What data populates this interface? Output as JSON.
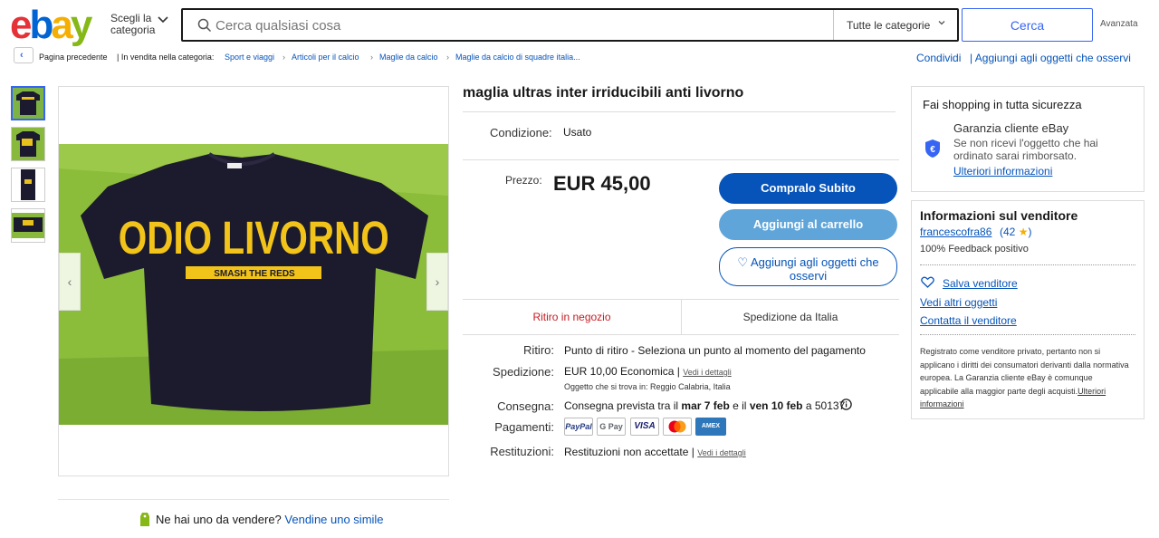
{
  "header": {
    "logo": [
      "e",
      "b",
      "a",
      "y"
    ],
    "shop_by_line1": "Scegli la",
    "shop_by_line2": "categoria",
    "search_placeholder": "Cerca qualsiasi cosa",
    "category_select": "Tutte le categorie",
    "search_button": "Cerca",
    "advanced": "Avanzata"
  },
  "breadcrumb": {
    "back": "Pagina precedente",
    "prefix": "| In vendita nella categoria:",
    "items": [
      "Sport e viaggi",
      "Articoli per il calcio",
      "Maglie da calcio",
      "Maglie da calcio di squadre italia..."
    ],
    "share": "Condividi",
    "add_watch": "| Aggiungi agli oggetti che osservi"
  },
  "item": {
    "title": "maglia ultras inter irriducibili anti livorno",
    "condition_label": "Condizione:",
    "condition_value": "Usato",
    "price_label": "Prezzo:",
    "price": "EUR 45,00",
    "buy_now": "Compralo Subito",
    "add_to_cart": "Aggiungi al carrello",
    "watch_line1": "♡ Aggiungi agli oggetti che",
    "watch_line2": "osservi",
    "shirt_text": "ODIO LIVORNO",
    "shirt_subtext": "SMASH THE REDS"
  },
  "tabs": {
    "pickup": "Ritiro in negozio",
    "shipping_from": "Spedizione da Italia"
  },
  "details": {
    "pickup_label": "Ritiro:",
    "pickup_value": "Punto di ritiro - Seleziona un punto al momento del pagamento",
    "shipping_label": "Spedizione:",
    "shipping_price": "EUR 10,00",
    "shipping_type": "Economica |",
    "shipping_link": "Vedi i dettagli",
    "location_note": "Oggetto che si trova in: Reggio Calabria, Italia",
    "delivery_label": "Consegna:",
    "delivery_pre": "Consegna prevista tra il",
    "delivery_d1": "mar 7 feb",
    "delivery_mid": "e il",
    "delivery_d2": "ven 10 feb",
    "delivery_post": "a 50137",
    "payments_label": "Pagamenti:",
    "payments": [
      "PayPal",
      "G Pay",
      "VISA",
      "",
      "AMEX"
    ],
    "returns_label": "Restituzioni:",
    "returns_value": "Restituzioni non accettate |",
    "returns_link": "Vedi i dettagli"
  },
  "sell": {
    "question": "Ne hai uno da vendere?",
    "link": "Vendine uno simile"
  },
  "safety": {
    "title": "Fai shopping in tutta sicurezza",
    "guarantee_title": "Garanzia cliente eBay",
    "guarantee_line1": "Se non ricevi l'oggetto che hai",
    "guarantee_line2": "ordinato sarai rimborsato.",
    "more_info": "Ulteriori informazioni"
  },
  "seller": {
    "title": "Informazioni sul venditore",
    "name": "francescofra86",
    "feedback_count": "42",
    "feedback_pct": "100% Feedback positivo",
    "save": "Salva venditore",
    "other_items": "Vedi altri oggetti",
    "contact": "Contatta il venditore",
    "legal": "Registrato come venditore privato, pertanto non si applicano i diritti dei consumatori derivanti dalla normativa europea. La Garanzia cliente eBay è comunque applicabile alla maggior parte degli acquisti.",
    "legal_link": "Ulteriori informazioni"
  },
  "colors": {
    "link": "#0654ba",
    "primary_button": "#0654ba",
    "secondary_button": "#5fa5d9",
    "pickup_tab": "#c41d24",
    "star": "#f5af02"
  }
}
